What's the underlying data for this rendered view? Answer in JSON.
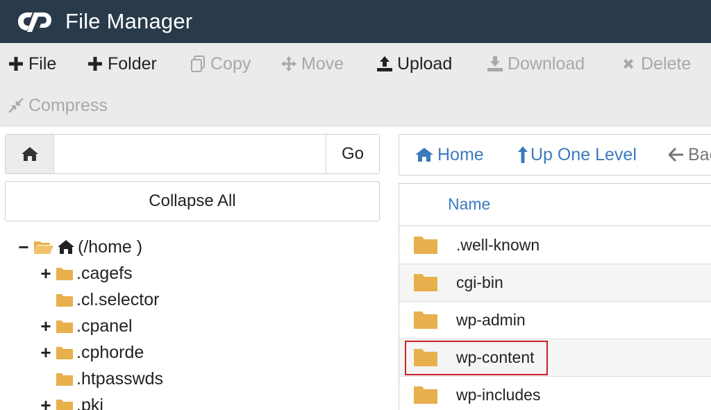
{
  "app": {
    "title": "File Manager",
    "logo_text": "cP"
  },
  "toolbar": {
    "file": "File",
    "folder": "Folder",
    "copy": "Copy",
    "move": "Move",
    "upload": "Upload",
    "download": "Download",
    "delete": "Delete",
    "compress": "Compress"
  },
  "path": {
    "value": "",
    "go_label": "Go"
  },
  "collapse_all": "Collapse All",
  "tree": {
    "root": "(/home )",
    "items": [
      {
        "label": ".cagefs",
        "expandable": "+"
      },
      {
        "label": ".cl.selector",
        "expandable": ""
      },
      {
        "label": ".cpanel",
        "expandable": "+"
      },
      {
        "label": ".cphorde",
        "expandable": "+"
      },
      {
        "label": ".htpasswds",
        "expandable": ""
      },
      {
        "label": ".pki",
        "expandable": "+"
      }
    ],
    "root_toggle": "−"
  },
  "nav": {
    "home": "Home",
    "up_one_level": "Up One Level",
    "back": "Back"
  },
  "list": {
    "column_name": "Name",
    "rows": [
      {
        "name": ".well-known"
      },
      {
        "name": "cgi-bin"
      },
      {
        "name": "wp-admin"
      },
      {
        "name": "wp-content",
        "highlighted": true
      },
      {
        "name": "wp-includes"
      }
    ]
  },
  "colors": {
    "header_bg": "#293a4a",
    "link_blue": "#3a7bbf",
    "folder": "#e8b04d",
    "highlight": "#c9202a"
  }
}
